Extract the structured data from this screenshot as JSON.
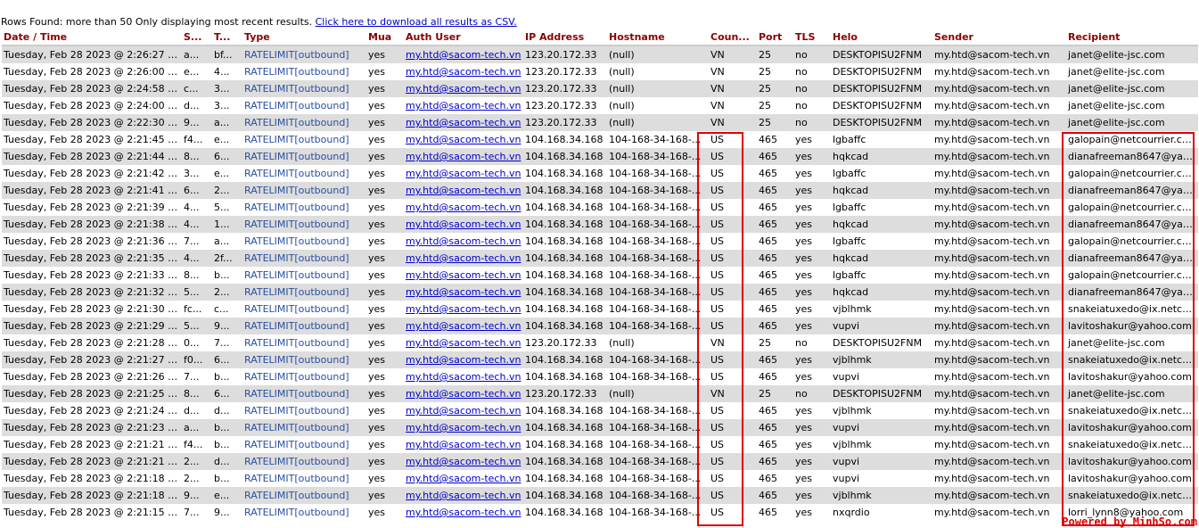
{
  "summary": {
    "text": "Rows Found: more than 50 Only displaying most recent results.",
    "link": "Click here to download all results as CSV."
  },
  "columns": [
    "Date / Time",
    "S...",
    "T...",
    "Type",
    "Mua",
    "Auth User",
    "IP Address",
    "Hostname",
    "Coun...",
    "Port",
    "TLS",
    "Helo",
    "Sender",
    "Recipient"
  ],
  "rows": [
    [
      "Tuesday, Feb 28 2023 @ 2:26:27 PM",
      "a...",
      "bf...",
      "RATELIMIT[outbound]",
      "yes",
      "my.htd@sacom-tech.vn",
      "123.20.172.33",
      "(null)",
      "VN",
      "25",
      "no",
      "DESKTOPISU2FNM",
      "my.htd@sacom-tech.vn",
      "janet@elite-jsc.com"
    ],
    [
      "Tuesday, Feb 28 2023 @ 2:26:00 PM",
      "e...",
      "4...",
      "RATELIMIT[outbound]",
      "yes",
      "my.htd@sacom-tech.vn",
      "123.20.172.33",
      "(null)",
      "VN",
      "25",
      "no",
      "DESKTOPISU2FNM",
      "my.htd@sacom-tech.vn",
      "janet@elite-jsc.com"
    ],
    [
      "Tuesday, Feb 28 2023 @ 2:24:58 PM",
      "c...",
      "3...",
      "RATELIMIT[outbound]",
      "yes",
      "my.htd@sacom-tech.vn",
      "123.20.172.33",
      "(null)",
      "VN",
      "25",
      "no",
      "DESKTOPISU2FNM",
      "my.htd@sacom-tech.vn",
      "janet@elite-jsc.com"
    ],
    [
      "Tuesday, Feb 28 2023 @ 2:24:00 PM",
      "d...",
      "3...",
      "RATELIMIT[outbound]",
      "yes",
      "my.htd@sacom-tech.vn",
      "123.20.172.33",
      "(null)",
      "VN",
      "25",
      "no",
      "DESKTOPISU2FNM",
      "my.htd@sacom-tech.vn",
      "janet@elite-jsc.com"
    ],
    [
      "Tuesday, Feb 28 2023 @ 2:22:30 PM",
      "9...",
      "a...",
      "RATELIMIT[outbound]",
      "yes",
      "my.htd@sacom-tech.vn",
      "123.20.172.33",
      "(null)",
      "VN",
      "25",
      "no",
      "DESKTOPISU2FNM",
      "my.htd@sacom-tech.vn",
      "janet@elite-jsc.com"
    ],
    [
      "Tuesday, Feb 28 2023 @ 2:21:45 PM",
      "f4...",
      "e...",
      "RATELIMIT[outbound]",
      "yes",
      "my.htd@sacom-tech.vn",
      "104.168.34.168",
      "104-168-34-168-...",
      "US",
      "465",
      "yes",
      "lgbaffc",
      "my.htd@sacom-tech.vn",
      "galopain@netcourrier.com"
    ],
    [
      "Tuesday, Feb 28 2023 @ 2:21:44 PM",
      "8...",
      "6...",
      "RATELIMIT[outbound]",
      "yes",
      "my.htd@sacom-tech.vn",
      "104.168.34.168",
      "104-168-34-168-...",
      "US",
      "465",
      "yes",
      "hqkcad",
      "my.htd@sacom-tech.vn",
      "dianafreeman8647@yahoo..."
    ],
    [
      "Tuesday, Feb 28 2023 @ 2:21:42 PM",
      "3...",
      "e...",
      "RATELIMIT[outbound]",
      "yes",
      "my.htd@sacom-tech.vn",
      "104.168.34.168",
      "104-168-34-168-...",
      "US",
      "465",
      "yes",
      "lgbaffc",
      "my.htd@sacom-tech.vn",
      "galopain@netcourrier.com"
    ],
    [
      "Tuesday, Feb 28 2023 @ 2:21:41 PM",
      "6...",
      "2...",
      "RATELIMIT[outbound]",
      "yes",
      "my.htd@sacom-tech.vn",
      "104.168.34.168",
      "104-168-34-168-...",
      "US",
      "465",
      "yes",
      "hqkcad",
      "my.htd@sacom-tech.vn",
      "dianafreeman8647@yahoo..."
    ],
    [
      "Tuesday, Feb 28 2023 @ 2:21:39 PM",
      "4...",
      "5...",
      "RATELIMIT[outbound]",
      "yes",
      "my.htd@sacom-tech.vn",
      "104.168.34.168",
      "104-168-34-168-...",
      "US",
      "465",
      "yes",
      "lgbaffc",
      "my.htd@sacom-tech.vn",
      "galopain@netcourrier.com"
    ],
    [
      "Tuesday, Feb 28 2023 @ 2:21:38 PM",
      "4...",
      "1...",
      "RATELIMIT[outbound]",
      "yes",
      "my.htd@sacom-tech.vn",
      "104.168.34.168",
      "104-168-34-168-...",
      "US",
      "465",
      "yes",
      "hqkcad",
      "my.htd@sacom-tech.vn",
      "dianafreeman8647@yahoo..."
    ],
    [
      "Tuesday, Feb 28 2023 @ 2:21:36 PM",
      "7...",
      "a...",
      "RATELIMIT[outbound]",
      "yes",
      "my.htd@sacom-tech.vn",
      "104.168.34.168",
      "104-168-34-168-...",
      "US",
      "465",
      "yes",
      "lgbaffc",
      "my.htd@sacom-tech.vn",
      "galopain@netcourrier.com"
    ],
    [
      "Tuesday, Feb 28 2023 @ 2:21:35 PM",
      "4...",
      "2f...",
      "RATELIMIT[outbound]",
      "yes",
      "my.htd@sacom-tech.vn",
      "104.168.34.168",
      "104-168-34-168-...",
      "US",
      "465",
      "yes",
      "hqkcad",
      "my.htd@sacom-tech.vn",
      "dianafreeman8647@yahoo..."
    ],
    [
      "Tuesday, Feb 28 2023 @ 2:21:33 PM",
      "8...",
      "b...",
      "RATELIMIT[outbound]",
      "yes",
      "my.htd@sacom-tech.vn",
      "104.168.34.168",
      "104-168-34-168-...",
      "US",
      "465",
      "yes",
      "lgbaffc",
      "my.htd@sacom-tech.vn",
      "galopain@netcourrier.com"
    ],
    [
      "Tuesday, Feb 28 2023 @ 2:21:32 PM",
      "5...",
      "2...",
      "RATELIMIT[outbound]",
      "yes",
      "my.htd@sacom-tech.vn",
      "104.168.34.168",
      "104-168-34-168-...",
      "US",
      "465",
      "yes",
      "hqkcad",
      "my.htd@sacom-tech.vn",
      "dianafreeman8647@yahoo..."
    ],
    [
      "Tuesday, Feb 28 2023 @ 2:21:30 PM",
      "fc...",
      "c...",
      "RATELIMIT[outbound]",
      "yes",
      "my.htd@sacom-tech.vn",
      "104.168.34.168",
      "104-168-34-168-...",
      "US",
      "465",
      "yes",
      "vjblhmk",
      "my.htd@sacom-tech.vn",
      "snakeiatuxedo@ix.netcom...."
    ],
    [
      "Tuesday, Feb 28 2023 @ 2:21:29 PM",
      "5...",
      "9...",
      "RATELIMIT[outbound]",
      "yes",
      "my.htd@sacom-tech.vn",
      "104.168.34.168",
      "104-168-34-168-...",
      "US",
      "465",
      "yes",
      "vupvi",
      "my.htd@sacom-tech.vn",
      "lavitoshakur@yahoo.com"
    ],
    [
      "Tuesday, Feb 28 2023 @ 2:21:28 PM",
      "0...",
      "7...",
      "RATELIMIT[outbound]",
      "yes",
      "my.htd@sacom-tech.vn",
      "123.20.172.33",
      "(null)",
      "VN",
      "25",
      "no",
      "DESKTOPISU2FNM",
      "my.htd@sacom-tech.vn",
      "janet@elite-jsc.com"
    ],
    [
      "Tuesday, Feb 28 2023 @ 2:21:27 PM",
      "f0...",
      "6...",
      "RATELIMIT[outbound]",
      "yes",
      "my.htd@sacom-tech.vn",
      "104.168.34.168",
      "104-168-34-168-...",
      "US",
      "465",
      "yes",
      "vjblhmk",
      "my.htd@sacom-tech.vn",
      "snakeiatuxedo@ix.netcom...."
    ],
    [
      "Tuesday, Feb 28 2023 @ 2:21:26 PM",
      "7...",
      "b...",
      "RATELIMIT[outbound]",
      "yes",
      "my.htd@sacom-tech.vn",
      "104.168.34.168",
      "104-168-34-168-...",
      "US",
      "465",
      "yes",
      "vupvi",
      "my.htd@sacom-tech.vn",
      "lavitoshakur@yahoo.com"
    ],
    [
      "Tuesday, Feb 28 2023 @ 2:21:25 PM",
      "8...",
      "6...",
      "RATELIMIT[outbound]",
      "yes",
      "my.htd@sacom-tech.vn",
      "123.20.172.33",
      "(null)",
      "VN",
      "25",
      "no",
      "DESKTOPISU2FNM",
      "my.htd@sacom-tech.vn",
      "janet@elite-jsc.com"
    ],
    [
      "Tuesday, Feb 28 2023 @ 2:21:24 PM",
      "d...",
      "d...",
      "RATELIMIT[outbound]",
      "yes",
      "my.htd@sacom-tech.vn",
      "104.168.34.168",
      "104-168-34-168-...",
      "US",
      "465",
      "yes",
      "vjblhmk",
      "my.htd@sacom-tech.vn",
      "snakeiatuxedo@ix.netcom...."
    ],
    [
      "Tuesday, Feb 28 2023 @ 2:21:23 PM",
      "a...",
      "b...",
      "RATELIMIT[outbound]",
      "yes",
      "my.htd@sacom-tech.vn",
      "104.168.34.168",
      "104-168-34-168-...",
      "US",
      "465",
      "yes",
      "vupvi",
      "my.htd@sacom-tech.vn",
      "lavitoshakur@yahoo.com"
    ],
    [
      "Tuesday, Feb 28 2023 @ 2:21:21 PM",
      "f4...",
      "b...",
      "RATELIMIT[outbound]",
      "yes",
      "my.htd@sacom-tech.vn",
      "104.168.34.168",
      "104-168-34-168-...",
      "US",
      "465",
      "yes",
      "vjblhmk",
      "my.htd@sacom-tech.vn",
      "snakeiatuxedo@ix.netcom...."
    ],
    [
      "Tuesday, Feb 28 2023 @ 2:21:21 PM",
      "2...",
      "d...",
      "RATELIMIT[outbound]",
      "yes",
      "my.htd@sacom-tech.vn",
      "104.168.34.168",
      "104-168-34-168-...",
      "US",
      "465",
      "yes",
      "vupvi",
      "my.htd@sacom-tech.vn",
      "lavitoshakur@yahoo.com"
    ],
    [
      "Tuesday, Feb 28 2023 @ 2:21:18 PM",
      "2...",
      "b...",
      "RATELIMIT[outbound]",
      "yes",
      "my.htd@sacom-tech.vn",
      "104.168.34.168",
      "104-168-34-168-...",
      "US",
      "465",
      "yes",
      "vupvi",
      "my.htd@sacom-tech.vn",
      "lavitoshakur@yahoo.com"
    ],
    [
      "Tuesday, Feb 28 2023 @ 2:21:18 PM",
      "9...",
      "e...",
      "RATELIMIT[outbound]",
      "yes",
      "my.htd@sacom-tech.vn",
      "104.168.34.168",
      "104-168-34-168-...",
      "US",
      "465",
      "yes",
      "vjblhmk",
      "my.htd@sacom-tech.vn",
      "snakeiatuxedo@ix.netcom...."
    ],
    [
      "Tuesday, Feb 28 2023 @ 2:21:15 PM",
      "7...",
      "9...",
      "RATELIMIT[outbound]",
      "yes",
      "my.htd@sacom-tech.vn",
      "104.168.34.168",
      "104-168-34-168-...",
      "US",
      "465",
      "yes",
      "nxqrdio",
      "my.htd@sacom-tech.vn",
      "lorri_lynn8@yahoo.com"
    ]
  ],
  "footer": "Powered by MinhSo.com",
  "colors": {
    "header_text": "#8b0000",
    "row_alt": "#dddddd",
    "link": "#0000cc",
    "type_text": "#2a4fa0",
    "highlight": "#e00000"
  }
}
